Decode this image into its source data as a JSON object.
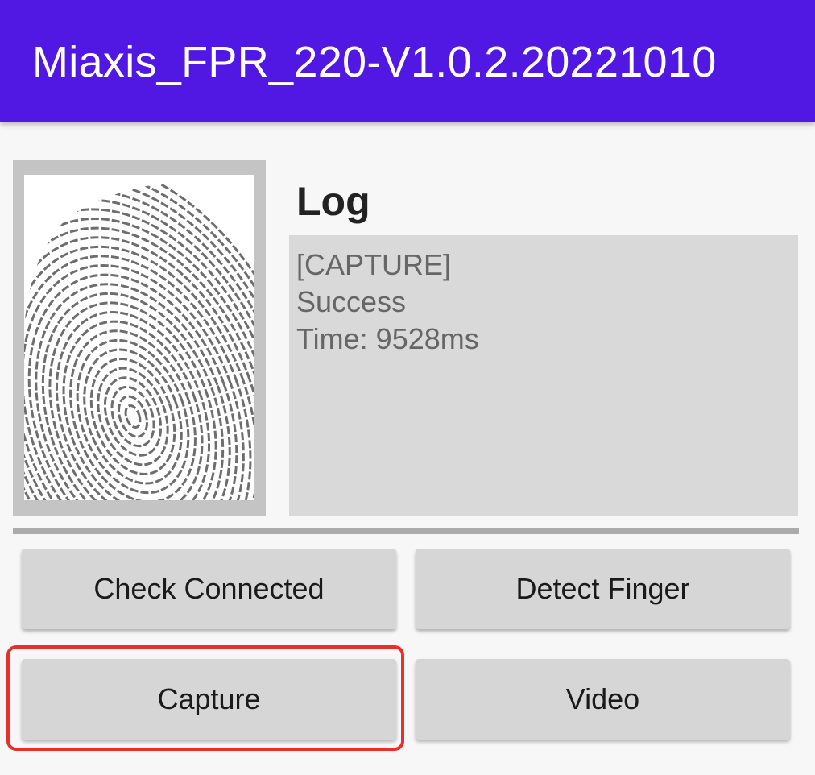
{
  "app_bar": {
    "title": "Miaxis_FPR_220-V1.0.2.20221010",
    "color": "#5018e2"
  },
  "fingerprint": {
    "icon": "fingerprint-image"
  },
  "log": {
    "title": "Log",
    "lines": [
      "[CAPTURE]",
      "Success",
      "Time: 9528ms"
    ]
  },
  "buttons": {
    "check_connected": "Check Connected",
    "detect_finger": "Detect Finger",
    "capture": "Capture",
    "video": "Video"
  },
  "highlight_color": "#e8302b"
}
